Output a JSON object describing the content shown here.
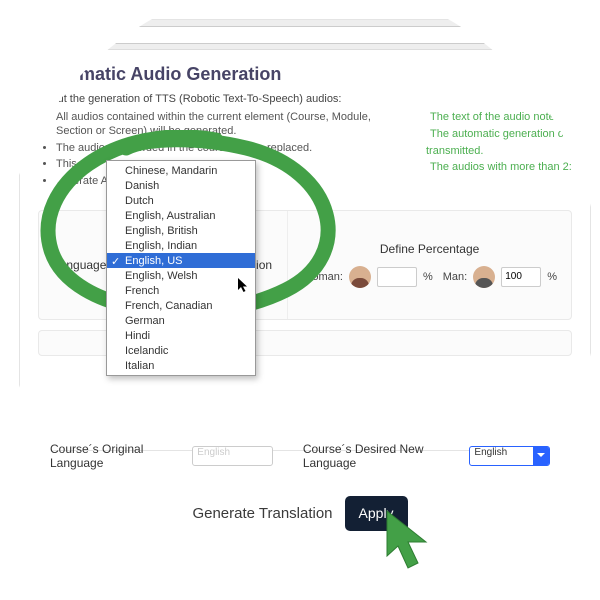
{
  "colors": {
    "accent_green": "#43A047",
    "title": "#474466",
    "apply_bg": "#132034"
  },
  "page_title": "Automatic Audio Generation",
  "subtitle": "About the generation of TTS (Robotic Text-To-Speech) audios:",
  "bullets_left": [
    "All audios contained within the current element (Course, Module, Section or Screen) will be generated.",
    "The audios that …ded in the course will be replaced.",
    "This …",
    "…nerate Audio button."
  ],
  "bullets_right": [
    "The text of the audio notes w",
    "The automatic generation of",
    "transmitted.",
    "The audios with more than 2:"
  ],
  "panel": {
    "language_label": "Language",
    "assign_label": "Assign Locution",
    "define_pct_label": "Define Percentage",
    "woman_label": "Woman:",
    "man_label": "Man:",
    "woman_value": "",
    "man_value": "100",
    "pct_sign": "%"
  },
  "dropdown": {
    "options": [
      "Chinese, Mandarin",
      "Danish",
      "Dutch",
      "English, Australian",
      "English, British",
      "English, Indian",
      "English, US",
      "English, Welsh",
      "French",
      "French, Canadian",
      "German",
      "Hindi",
      "Icelandic",
      "Italian"
    ],
    "selected_index": 6
  },
  "translate": {
    "orig_label": "Course´s Original Language",
    "orig_value": "English",
    "new_label": "Course´s Desired New Language",
    "new_value": "English",
    "generate_label": "Generate Translation",
    "apply_label": "Apply"
  }
}
